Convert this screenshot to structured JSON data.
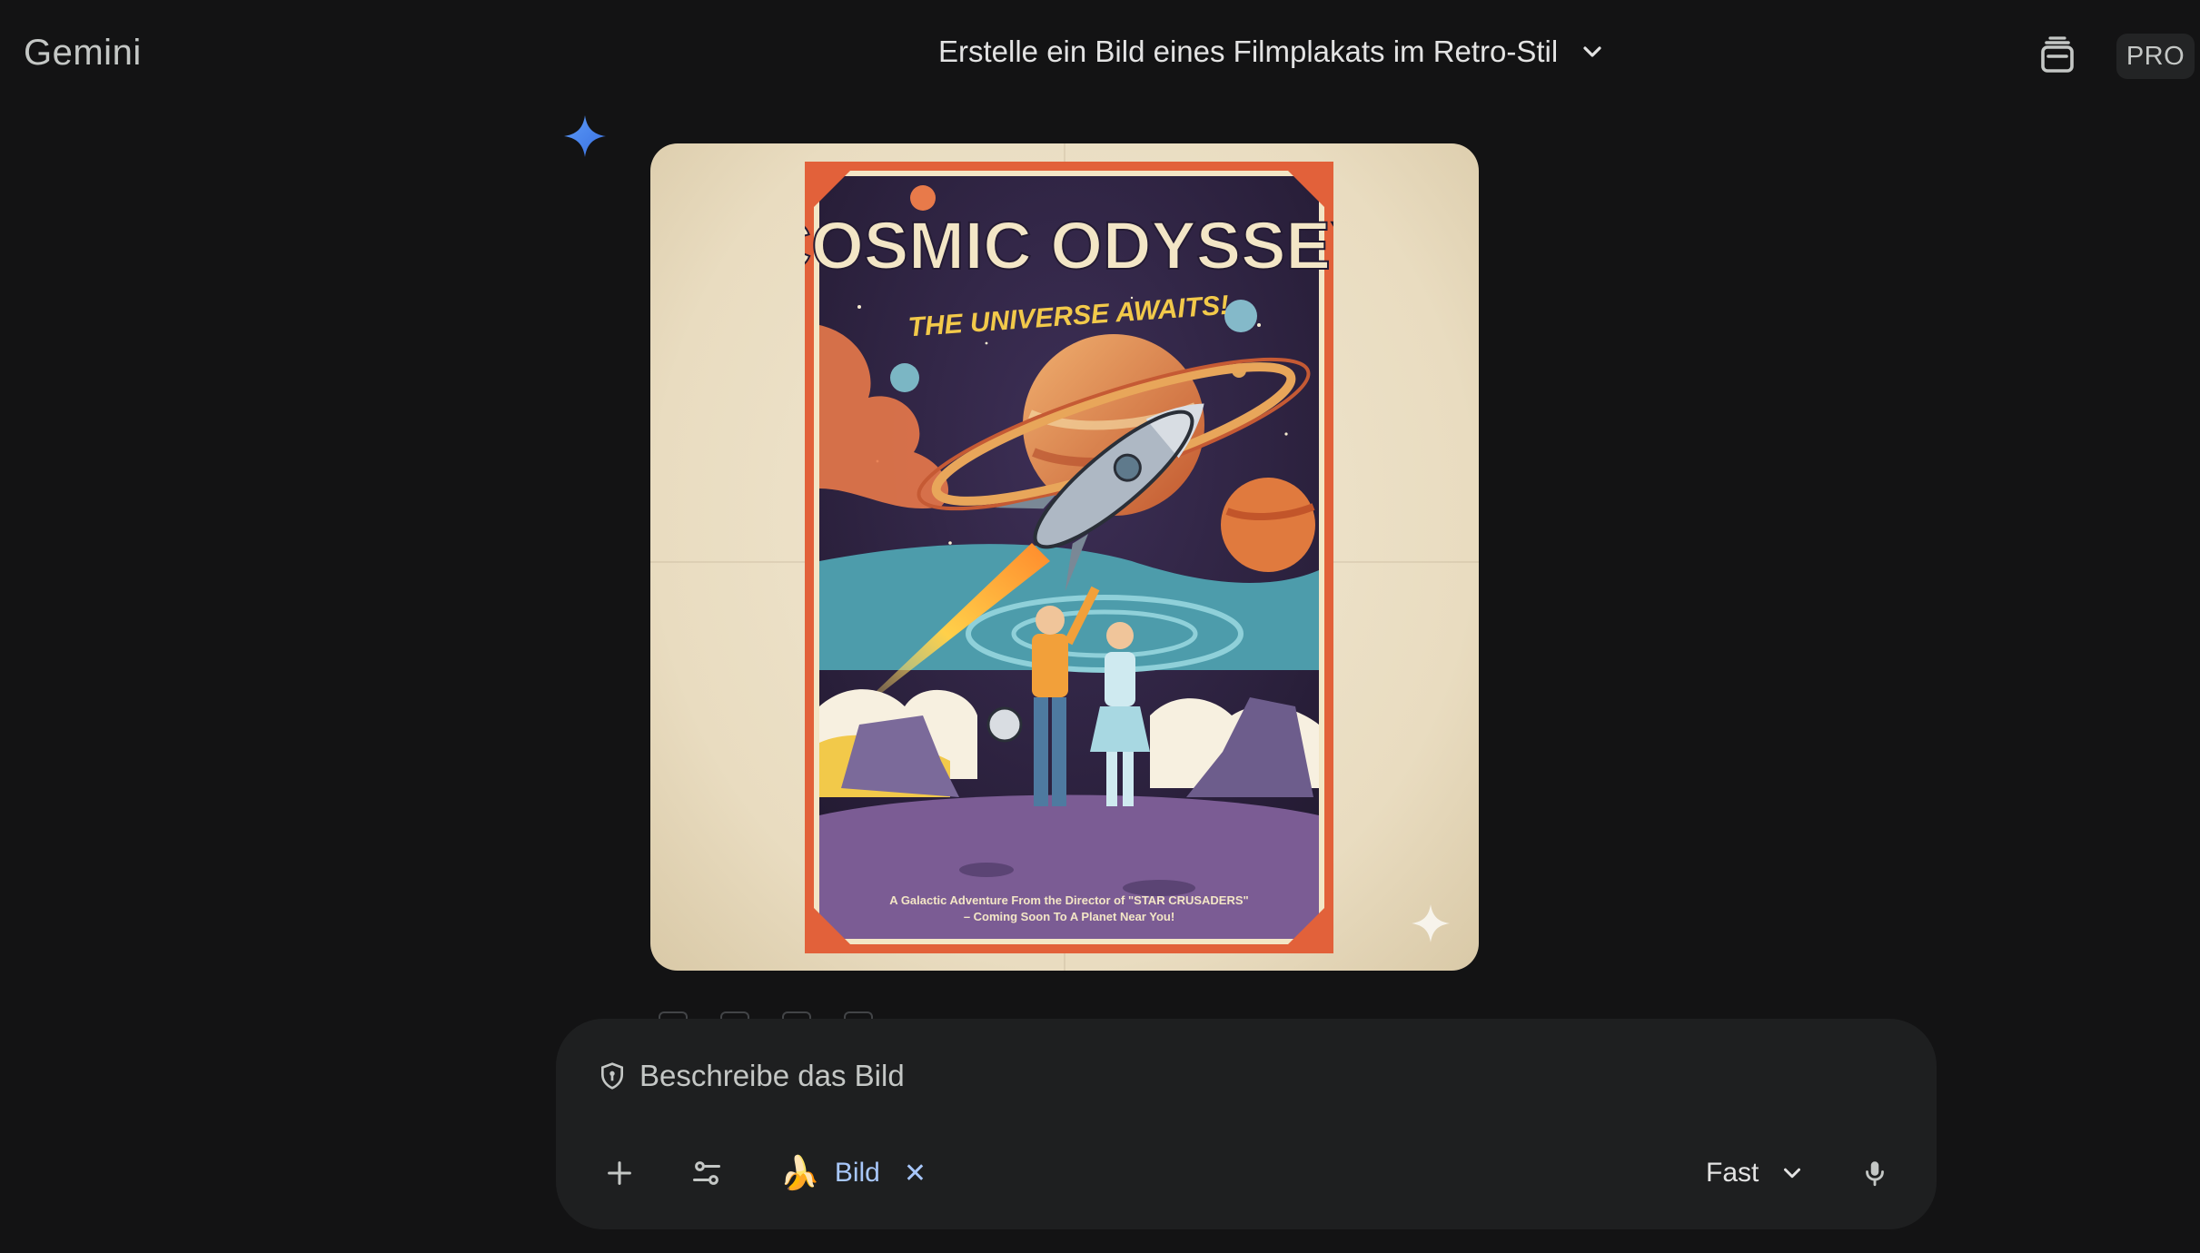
{
  "header": {
    "brand": "Gemini",
    "conversation_title": "Erstelle ein Bild eines Filmplakats im Retro-Stil",
    "pro_badge": "PRO",
    "temporary_chat_icon": "temporary-chat-icon"
  },
  "response": {
    "sparkle_icon": "gemini-sparkle-icon",
    "image": {
      "alt": "Retro sci-fi movie poster",
      "poster_title": "COSMIC ODYSSEY",
      "poster_tagline": "THE UNIVERSE AWAITS!",
      "poster_footer_line1": "A Galactic Adventure From the Director of \"STAR CRUSADERS\"",
      "poster_footer_line2": "– Coming Soon To A Planet Near You!",
      "watermark_icon": "sparkle-watermark-icon"
    }
  },
  "composer": {
    "placeholder": "Beschreibe das Bild",
    "tool_chip": {
      "icon": "🍌",
      "label": "Bild",
      "remove": "✕"
    },
    "mode": "Fast"
  },
  "colors": {
    "background": "#131314",
    "surface": "#1e1f20",
    "accent": "#a8c7fa",
    "sparkle": "#4c8df6"
  }
}
